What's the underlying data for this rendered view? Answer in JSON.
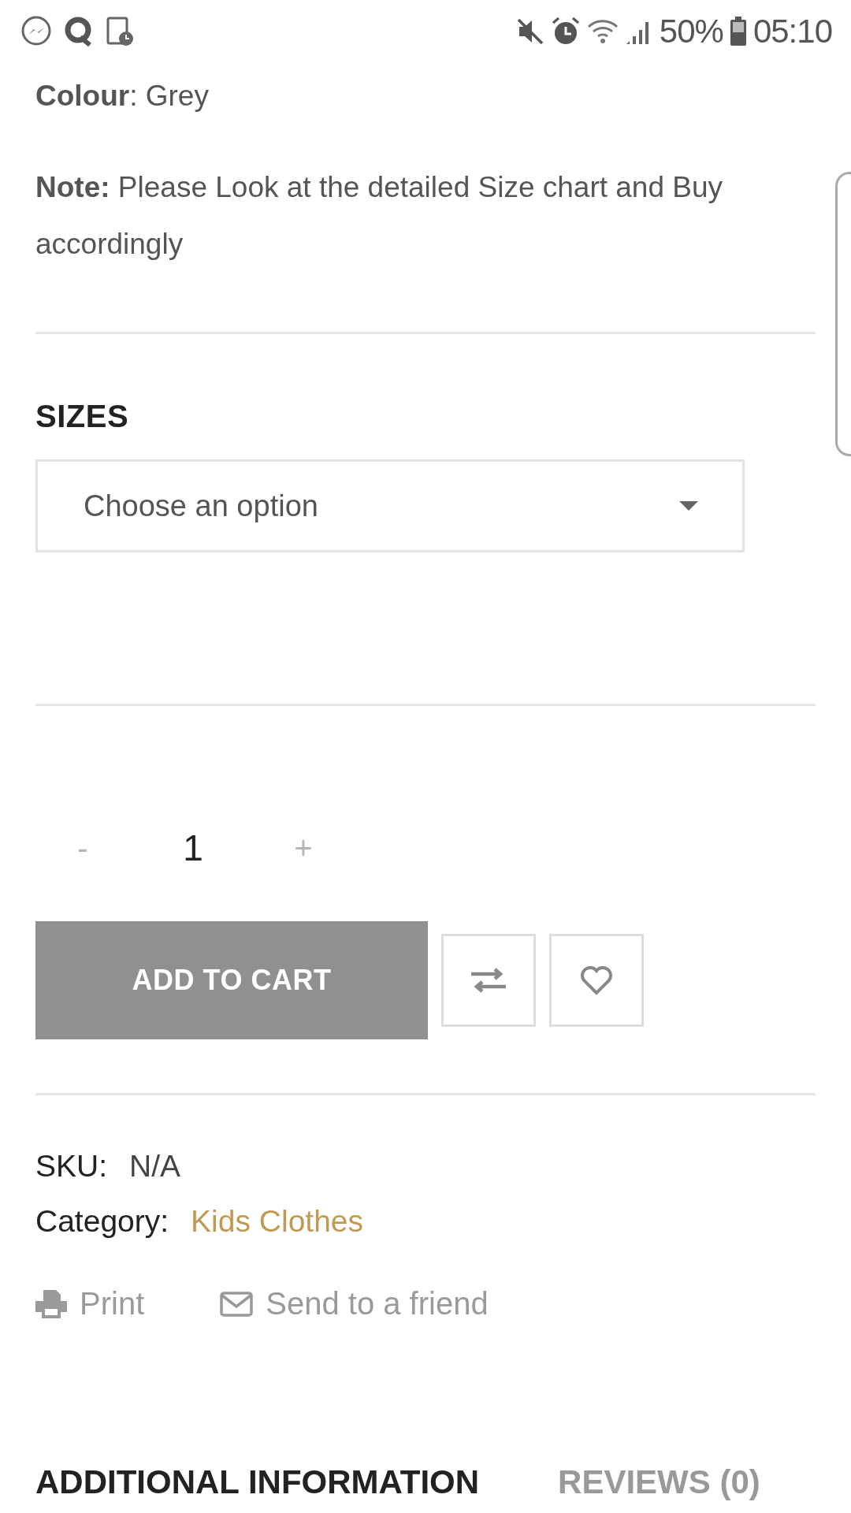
{
  "status_bar": {
    "battery": "50%",
    "time": "05:10"
  },
  "details": {
    "colour_label": "Colour",
    "colour_value": ": Grey",
    "note": "**Note:** Please Look at the detailed Size chart and Buy accordingly"
  },
  "sizes": {
    "title": "SIZES",
    "select_value": "Choose an option"
  },
  "quantity": {
    "minus": "-",
    "value": "1",
    "plus": "+"
  },
  "add_to_cart": "ADD TO CART",
  "meta": {
    "sku_label": "SKU:",
    "sku_value": "N/A",
    "category_label": "Category:",
    "category_value": "Kids Clothes"
  },
  "share": [
    {
      "kind": "print",
      "label": "Print"
    },
    {
      "kind": "email",
      "label": "Send to a friend"
    }
  ],
  "tabs": [
    {
      "label": "ADDITIONAL INFORMATION",
      "selected": true
    },
    {
      "label": "REVIEWS (0)",
      "selected": false
    }
  ]
}
